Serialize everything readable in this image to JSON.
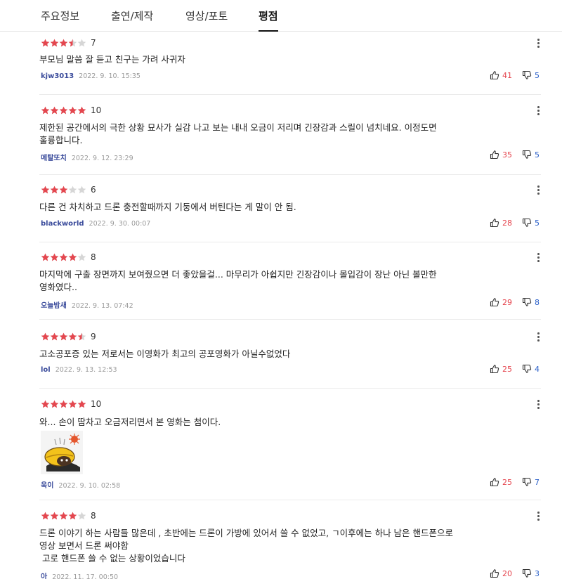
{
  "tabs": [
    {
      "label": "주요정보"
    },
    {
      "label": "출연/제작"
    },
    {
      "label": "영상/포토"
    },
    {
      "label": "평점",
      "active": true
    }
  ],
  "colors": {
    "star": "#e4474f",
    "star_empty": "#d6d6d6",
    "author": "#3a4b9b",
    "like": "#e5454e",
    "dislike": "#2c61c9"
  },
  "icons": {
    "like": "thumbs-up-icon",
    "dislike": "thumbs-down-icon",
    "more": "more-vertical-icon",
    "star": "star-icon"
  },
  "reviews": [
    {
      "rating": 7,
      "score_label": "7",
      "lines": [
        "부모님 말씀 잘 듣고 친구는 가려 사귀자"
      ],
      "author": "kjw3013",
      "date": "2022. 9. 10. 15:35",
      "likes": "41",
      "dislikes": "5"
    },
    {
      "rating": 10,
      "score_label": "10",
      "lines": [
        "제한된 공간에서의 극한 상황 묘사가 실감 나고 보는 내내 오금이 저리며 긴장감과 스릴이 넘치네요. 이정도면",
        "훌륭합니다."
      ],
      "author": "메탈또치",
      "date": "2022. 9. 12. 23:29",
      "likes": "35",
      "dislikes": "5"
    },
    {
      "rating": 6,
      "score_label": "6",
      "lines": [
        "다른 건 차치하고 드론 충전할때까지 기둥에서 버틴다는 게 말이 안 됨."
      ],
      "author": "blackworld",
      "date": "2022. 9. 30. 00:07",
      "likes": "28",
      "dislikes": "5"
    },
    {
      "rating": 8,
      "score_label": "8",
      "lines": [
        "마지막에 구출 장면까지 보여줬으면 더 좋았을걸... 마무리가 아쉽지만 긴장감이나 몰입감이 장난 아닌 볼만한",
        "영화였다.."
      ],
      "author": "오늘밤새",
      "date": "2022. 9. 13. 07:42",
      "likes": "29",
      "dislikes": "8"
    },
    {
      "rating": 9,
      "score_label": "9",
      "lines": [
        "고소공포증 있는 저로서는 이영화가 최고의 공포영화가 아닐수없었다"
      ],
      "author": "lol",
      "date": "2022. 9. 13. 12:53",
      "likes": "25",
      "dislikes": "4"
    },
    {
      "rating": 10,
      "score_label": "10",
      "lines": [
        "와... 손이 땀차고 오금저리면서 본 영화는 첨이다."
      ],
      "author": "욱이",
      "date": "2022. 9. 10. 02:58",
      "likes": "25",
      "dislikes": "7",
      "sticker": "sweating-yellow-character-sticker"
    },
    {
      "rating": 8,
      "score_label": "8",
      "lines": [
        "드론 이야기 하는 사람들 많은데 , 초반에는 드론이 가방에 있어서 쓸 수 없었고, ㄱ이후에는 하나 남은 핸드폰으로",
        "영상 보면서 드론 써야함",
        " 고로 핸드폰 쓸 수 없는 상황이었습니다"
      ],
      "author": "아",
      "date": "2022. 11. 17. 00:50",
      "likes": "20",
      "dislikes": "3"
    }
  ]
}
